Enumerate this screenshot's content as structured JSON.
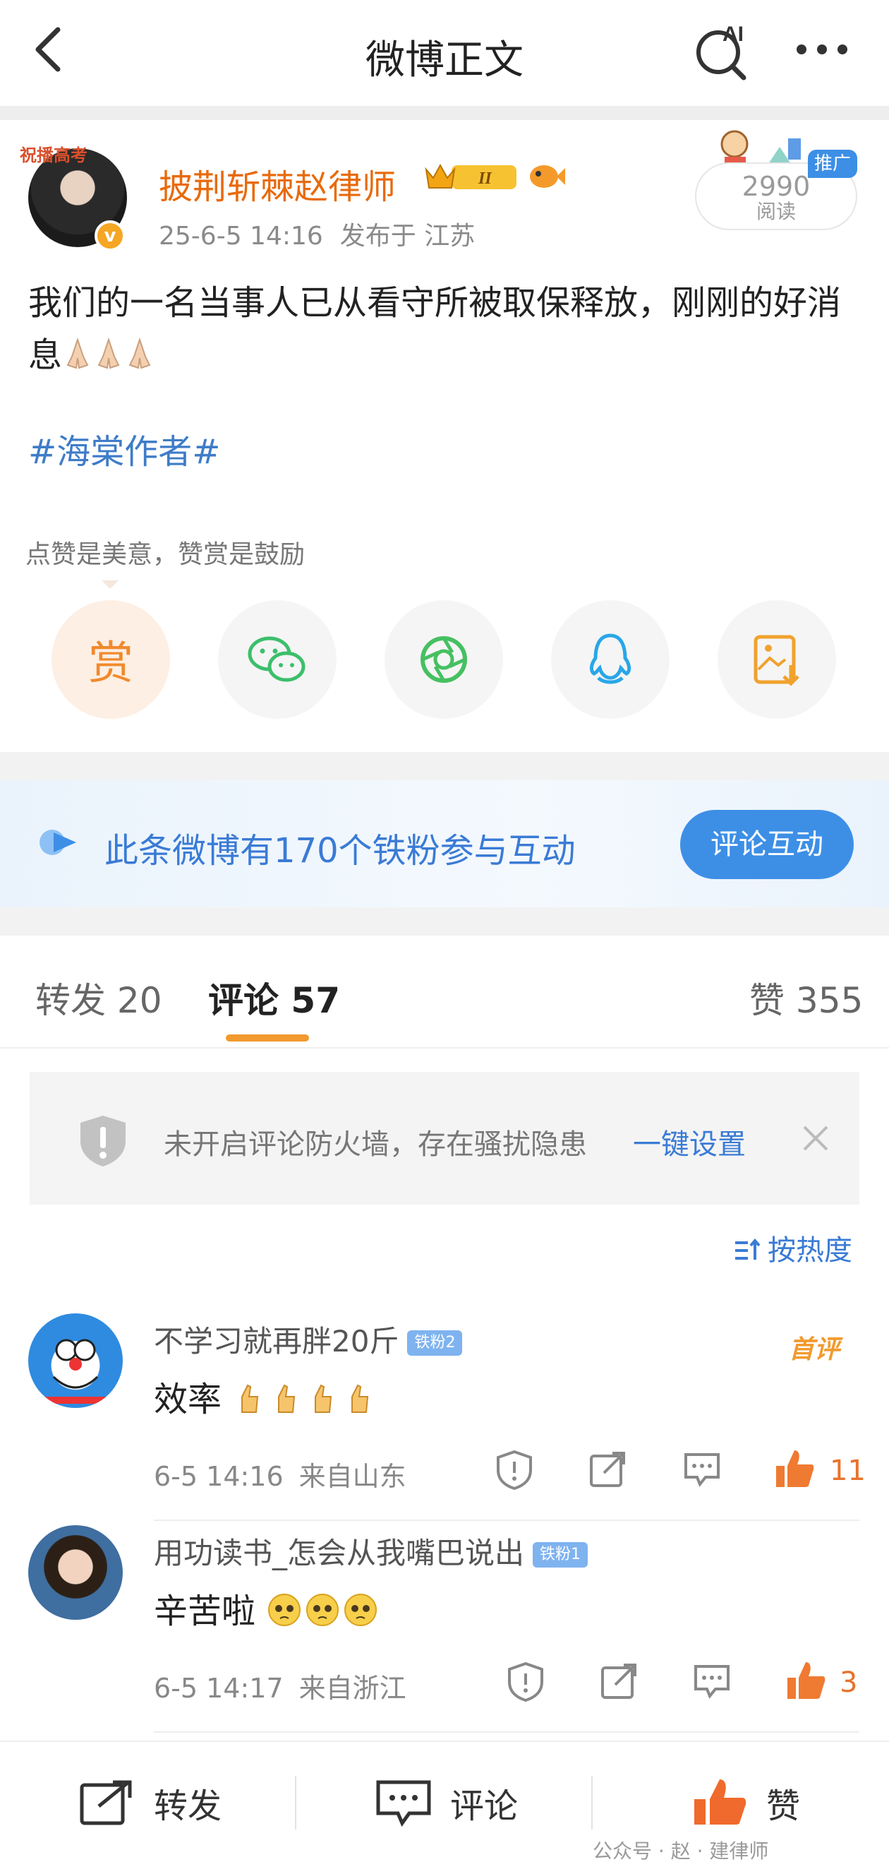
{
  "header": {
    "title": "微博正文",
    "ai_label": "AI"
  },
  "post": {
    "avatar_frame_text": "祝播高考",
    "author": "披荆斩棘赵律师",
    "crown_label": "II",
    "time": "25-6-5 14:16",
    "location": "发布于 江苏",
    "read_count": "2990",
    "read_label": "阅读",
    "promo_tag": "推广",
    "verify_mark": "v",
    "text": "我们的一名当事人已从看守所被取保释放，刚刚的好消息",
    "emoji": "folded-hands",
    "emoji_count": 3,
    "hashtag": "#海棠作者#"
  },
  "tip": {
    "text": "点赞是美意，赞赏是鼓励"
  },
  "share": {
    "reward_label": "赏",
    "items": [
      "reward",
      "wechat",
      "moments",
      "qq",
      "save-image"
    ]
  },
  "fan_banner": {
    "text": "此条微博有170个铁粉参与互动",
    "button": "评论互动"
  },
  "tabs": {
    "repost": "转发 20",
    "comments": "评论 57",
    "likes": "赞 355"
  },
  "firewall": {
    "text": "未开启评论防火墙，存在骚扰隐患",
    "link": "一键设置"
  },
  "sort": {
    "label": "按热度"
  },
  "comments": [
    {
      "user": "不学习就再胖20斤",
      "fan_badge": "铁粉2",
      "badge": "首评",
      "text": "效率",
      "emoji": "thumbs-up",
      "emoji_count": 4,
      "time": "6-5 14:16",
      "location": "来自山东",
      "likes": "11"
    },
    {
      "user": "用功读书_怎会从我嘴巴说出",
      "fan_badge": "铁粉1",
      "text": "辛苦啦",
      "emoji": "pleading-face",
      "emoji_count": 3,
      "time": "6-5 14:17",
      "location": "来自浙江",
      "likes": "3"
    }
  ],
  "bottom_bar": {
    "repost": "转发",
    "comment": "评论",
    "like": "赞"
  },
  "watermark": "公众号 · 赵 · 建律师",
  "colors": {
    "accent_orange": "#e86a0c",
    "link_blue": "#3a7bd5",
    "button_blue": "#3d8fe6"
  }
}
